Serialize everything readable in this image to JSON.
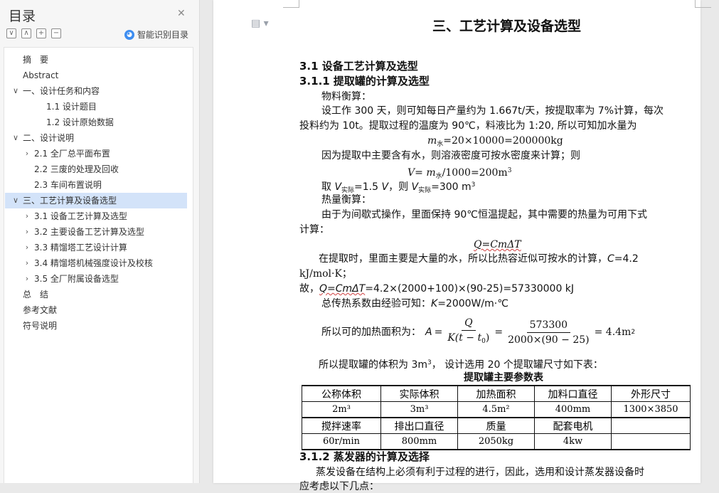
{
  "nav": {
    "title": "目录",
    "tools": [
      "∨",
      "∧",
      "+",
      "−"
    ],
    "smart_toc_label": "智能识别目录",
    "items": [
      {
        "label": "摘　要",
        "caret": ""
      },
      {
        "label": "Abstract",
        "caret": ""
      },
      {
        "label": "一、设计任务和内容",
        "caret": "∨"
      },
      {
        "label": "1.1  设计题目",
        "caret": ""
      },
      {
        "label": "1.2  设计原始数据",
        "caret": ""
      },
      {
        "label": "二、设计说明",
        "caret": "∨"
      },
      {
        "label": "2.1  全厂总平面布置",
        "caret": "›"
      },
      {
        "label": "2.2  三废的处理及回收",
        "caret": ""
      },
      {
        "label": "2.3  车间布置说明",
        "caret": ""
      },
      {
        "label": "三、工艺计算及设备选型",
        "caret": "∨"
      },
      {
        "label": "3.1  设备工艺计算及选型",
        "caret": "›"
      },
      {
        "label": "3.2  主要设备工艺计算及选型",
        "caret": "›"
      },
      {
        "label": "3.3  精馏塔工艺设计计算",
        "caret": "›"
      },
      {
        "label": "3.4  精馏塔机械强度设计及校核",
        "caret": "›"
      },
      {
        "label": "3.5  全厂附属设备选型",
        "caret": "›"
      },
      {
        "label": "总　结",
        "caret": ""
      },
      {
        "label": "参考文献",
        "caret": ""
      },
      {
        "label": "符号说明",
        "caret": ""
      }
    ]
  },
  "doc": {
    "chapter_title": "三、工艺计算及设备选型",
    "h_31": "3.1  设备工艺计算及选型",
    "h_311": "3.1.1  提取罐的计算及选型",
    "p1": "物料衡算：",
    "p2a": "设工作 300 天，则可知每日产量约为 1.667t/天，按提取率为 7%计算，每次",
    "p2b": "投料约为 10t。提取过程的温度为 90℃，料液比为 1:20, 所以可知加水量为",
    "eq1_m": "m",
    "eq1_sub": "水",
    "eq1_rest": "=20×10000=200000kg",
    "p3": "因为提取中主要含有水，则溶液密度可按水密度来计算；则",
    "eq2_V": "V",
    "eq2_mid": "= ",
    "eq2_m": "m",
    "eq2_sub": "水",
    "eq2_rest": "/1000=200m",
    "eq2_sup": "3",
    "p4_a": "取 ",
    "p4_V": "V",
    "p4_sub": "实际",
    "p4_b": "=1.5 ",
    "p4_V2": "V",
    "p4_c": "，则 ",
    "p4_V3": "V",
    "p4_sub2": "实际",
    "p4_d": "=300 m",
    "p4_sup": "3",
    "p5": "热量衡算：",
    "p6a": "由于为间歇式操作，里面保持 90℃恒温提起，其中需要的热量为可用下式",
    "p6b": "计算：",
    "eq3": "Q=CmΔT",
    "p7a": "在提取时，里面主要是大量的水，所以比热容近似可按水的计算，",
    "p7_C": "C",
    "p7_rest": "=4.2",
    "p7b": "kJ/mol·K；",
    "p8_a": "故，",
    "p8_eq": "Q=CmΔT",
    "p8_rest": "=4.2×(2000+100)×(90-25)=57330000 kJ",
    "p9_a": "总传热系数由经验可知：",
    "p9_K": "K",
    "p9_rest": "=2000W/m·℃",
    "p10_label": "所以可的加热面积为：",
    "p10_A": "A",
    "p10_eq": "=",
    "p10_num1": "Q",
    "p10_den1": "K(t − t",
    "p10_den1_sub": "0",
    "p10_den1_end": ")",
    "p10_num2": "573300",
    "p10_den2": "2000×(90 − 25)",
    "p10_result": "= 4.4m",
    "p10_sup": "2",
    "p11a": "所以提取罐的体积为 3m",
    "p11_sup": "3",
    "p11b": "， 设计选用 20 个提取罐尺寸如下表：",
    "table_caption": "提取罐主要参数表",
    "table": {
      "header1": [
        "公称体积",
        "实际体积",
        "加热面积",
        "加料口直径",
        "外形尺寸"
      ],
      "values1": [
        "2m³",
        "3m³",
        "4.5m²",
        "400mm",
        "1300×3850"
      ],
      "header2": [
        "搅拌速率",
        "排出口直径",
        "质量",
        "配套电机",
        ""
      ],
      "values2": [
        "60r/min",
        "800mm",
        "2050kg",
        "4kw",
        ""
      ]
    },
    "h_312": "3.1.2  蒸发器的计算及选择",
    "p12a": "蒸发设备在结构上必须有利于过程的进行，因此，选用和设计蒸发器设备时",
    "p12b": "应考虑以下几点："
  }
}
